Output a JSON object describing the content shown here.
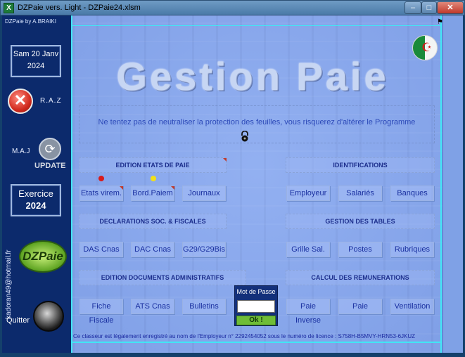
{
  "window": {
    "title": "DZPaie vers. Light - DZPaie24.xlsm",
    "minimize": "–",
    "maximize": "□",
    "close": "✕"
  },
  "sidebar": {
    "credit": "DZPaie by A.BRAIKI",
    "date_line1": "Sam 20 Janv",
    "date_line2": "2024",
    "raz_label": "R.A.Z",
    "maj_label": "M.A.J",
    "update_label": "UPDATE",
    "exercice_label": "Exercice",
    "exercice_year": "2024",
    "email": "kadoran49@hotmail.fr",
    "logo_text": "DZPaie",
    "quit_label": "Quitter"
  },
  "main": {
    "title": "Gestion Paie",
    "warning": "Ne tentez pas de neutraliser la protection des feuilles, vous risquerez d'altérer le Programme",
    "sections": {
      "edition_etats": "EDITION ETATS DE PAIE",
      "identifications": "IDENTIFICATIONS",
      "declarations": "DECLARATIONS SOC. & FISCALES",
      "gestion_tables": "GESTION DES TABLES",
      "edition_docs": "EDITION DOCUMENTS ADMINISTRATIFS",
      "calcul_remunerations": "CALCUL DES REMUNERATIONS"
    },
    "buttons": {
      "etats_virem": "Etats virem.",
      "bord_paiem": "Bord.Paiem",
      "journaux": "Journaux",
      "employeur": "Employeur",
      "salaries": "Salariés",
      "banques": "Banques",
      "das_cnas": "DAS Cnas",
      "dac_cnas": "DAC Cnas",
      "g29": "G29/G29Bis",
      "grille_sal": "Grille Sal.",
      "postes": "Postes",
      "rubriques": "Rubriques",
      "fiche_fiscale": "Fiche Fiscale",
      "ats_cnas": "ATS Cnas",
      "bulletins": "Bulletins",
      "paie_inverse": "Paie Inverse",
      "paie": "Paie",
      "ventilation": "Ventilation"
    },
    "password": {
      "label": "Mot de Passe",
      "value": "",
      "ok": "Ok !"
    },
    "footer": "Ce classeur est légalement enregistré au nom de l'Employeur n° 2292454052 sous le numéro de licence : S758H-B5MVY-HRN53-6JKUZ"
  },
  "colors": {
    "sidebar": "#0c2a6c",
    "main_bg": "#86a6ea",
    "accent_cyan": "#41e6f5",
    "button_text": "#1a30a0",
    "warning_text": "#2c49b8",
    "status_red": "#d81b1b",
    "status_yellow": "#f2e018",
    "ok_green": "#6fbd37"
  }
}
